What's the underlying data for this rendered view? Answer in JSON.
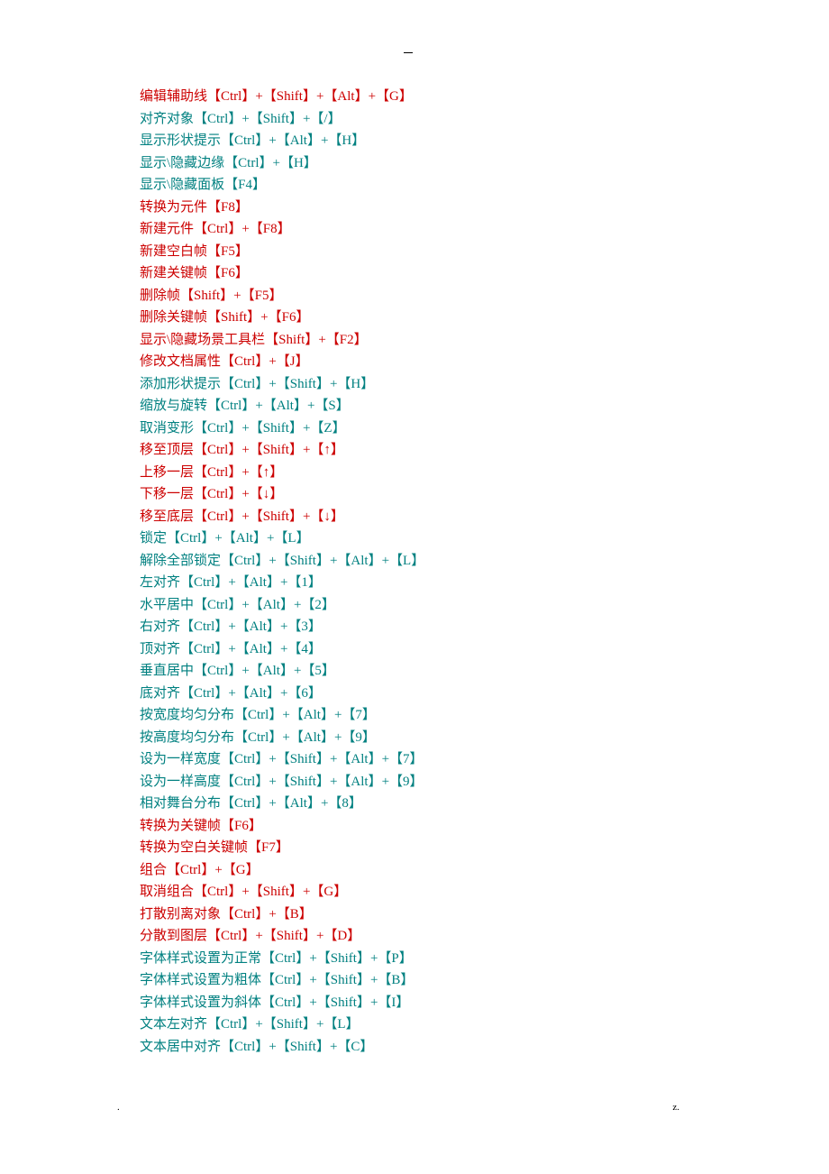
{
  "lines": [
    {
      "text": "编辑辅助线【Ctrl】+【Shift】+【Alt】+【G】",
      "color": "red"
    },
    {
      "text": "对齐对象【Ctrl】+【Shift】+【/】",
      "color": "teal"
    },
    {
      "text": "显示形状提示【Ctrl】+【Alt】+【H】",
      "color": "teal"
    },
    {
      "text": "显示\\隐藏边缘【Ctrl】+【H】",
      "color": "teal"
    },
    {
      "text": "显示\\隐藏面板【F4】",
      "color": "teal"
    },
    {
      "text": "转换为元件【F8】",
      "color": "red"
    },
    {
      "text": "新建元件【Ctrl】+【F8】",
      "color": "red"
    },
    {
      "text": "新建空白帧【F5】",
      "color": "red"
    },
    {
      "text": "新建关键帧【F6】",
      "color": "red"
    },
    {
      "text": "删除帧【Shift】+【F5】",
      "color": "red"
    },
    {
      "text": "删除关键帧【Shift】+【F6】",
      "color": "red"
    },
    {
      "text": "显示\\隐藏场景工具栏【Shift】+【F2】",
      "color": "red"
    },
    {
      "text": "修改文档属性【Ctrl】+【J】",
      "color": "red"
    },
    {
      "text": "添加形状提示【Ctrl】+【Shift】+【H】",
      "color": "teal"
    },
    {
      "text": "缩放与旋转【Ctrl】+【Alt】+【S】",
      "color": "teal"
    },
    {
      "text": "取消变形【Ctrl】+【Shift】+【Z】",
      "color": "teal"
    },
    {
      "text": "移至顶层【Ctrl】+【Shift】+【↑】",
      "color": "red"
    },
    {
      "text": "上移一层【Ctrl】+【↑】",
      "color": "red"
    },
    {
      "text": "下移一层【Ctrl】+【↓】",
      "color": "red"
    },
    {
      "text": "移至底层【Ctrl】+【Shift】+【↓】",
      "color": "red"
    },
    {
      "text": "锁定【Ctrl】+【Alt】+【L】",
      "color": "teal"
    },
    {
      "text": "解除全部锁定【Ctrl】+【Shift】+【Alt】+【L】",
      "color": "teal"
    },
    {
      "text": "左对齐【Ctrl】+【Alt】+【1】",
      "color": "teal"
    },
    {
      "text": "水平居中【Ctrl】+【Alt】+【2】",
      "color": "teal"
    },
    {
      "text": "右对齐【Ctrl】+【Alt】+【3】",
      "color": "teal"
    },
    {
      "text": "顶对齐【Ctrl】+【Alt】+【4】",
      "color": "teal"
    },
    {
      "text": "垂直居中【Ctrl】+【Alt】+【5】",
      "color": "teal"
    },
    {
      "text": "底对齐【Ctrl】+【Alt】+【6】",
      "color": "teal"
    },
    {
      "text": "按宽度均匀分布【Ctrl】+【Alt】+【7】",
      "color": "teal"
    },
    {
      "text": "按高度均匀分布【Ctrl】+【Alt】+【9】",
      "color": "teal"
    },
    {
      "text": "设为一样宽度【Ctrl】+【Shift】+【Alt】+【7】",
      "color": "teal"
    },
    {
      "text": "设为一样高度【Ctrl】+【Shift】+【Alt】+【9】",
      "color": "teal"
    },
    {
      "text": "相对舞台分布【Ctrl】+【Alt】+【8】",
      "color": "teal"
    },
    {
      "text": "转换为关键帧【F6】",
      "color": "red"
    },
    {
      "text": "转换为空白关键帧【F7】",
      "color": "red"
    },
    {
      "text": "组合【Ctrl】+【G】",
      "color": "red"
    },
    {
      "text": "取消组合【Ctrl】+【Shift】+【G】",
      "color": "red"
    },
    {
      "text": "打散别离对象【Ctrl】+【B】",
      "color": "red"
    },
    {
      "text": "分散到图层【Ctrl】+【Shift】+【D】",
      "color": "red"
    },
    {
      "text": "字体样式设置为正常【Ctrl】+【Shift】+【P】",
      "color": "teal"
    },
    {
      "text": "字体样式设置为粗体【Ctrl】+【Shift】+【B】",
      "color": "teal"
    },
    {
      "text": "字体样式设置为斜体【Ctrl】+【Shift】+【I】",
      "color": "teal"
    },
    {
      "text": "文本左对齐【Ctrl】+【Shift】+【L】",
      "color": "teal"
    },
    {
      "text": "文本居中对齐【Ctrl】+【Shift】+【C】",
      "color": "teal"
    }
  ],
  "footerLeft": ".",
  "footerRight": "z."
}
